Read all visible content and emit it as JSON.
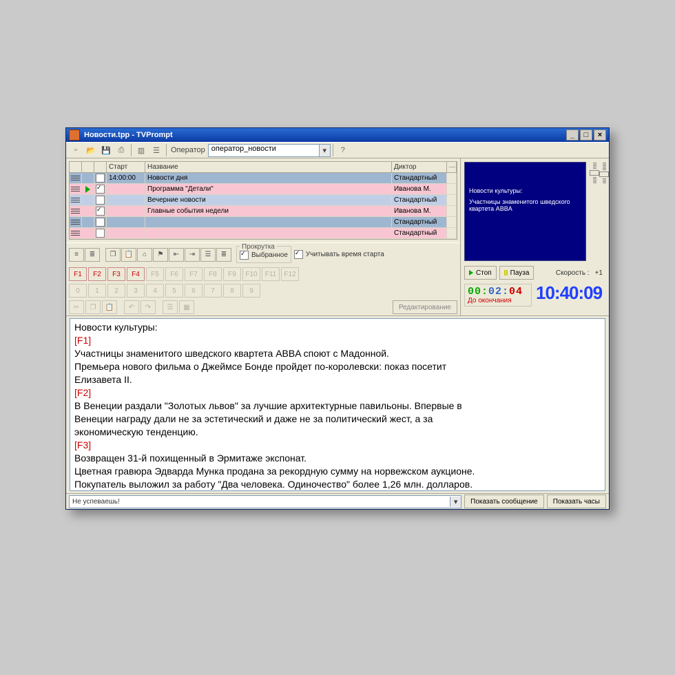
{
  "window": {
    "title": "Новости.tpp - TVPrompt"
  },
  "toolbar": {
    "operator_label": "Оператор",
    "operator_value": "оператор_новости"
  },
  "grid": {
    "headers": {
      "start": "Старт",
      "name": "Название",
      "speaker": "Диктор"
    },
    "rows": [
      {
        "cls": "row-blue",
        "playing": false,
        "checked": false,
        "start": "14:00:00",
        "name": "Новости дня",
        "speaker": "Стандартный"
      },
      {
        "cls": "row-pink",
        "playing": true,
        "checked": true,
        "start": "",
        "name": "Программа \"Детали\"",
        "speaker": "Иванова М."
      },
      {
        "cls": "row-sel",
        "playing": false,
        "checked": false,
        "start": "",
        "name": "Вечерние новости",
        "speaker": "Стандартный"
      },
      {
        "cls": "row-pink",
        "playing": false,
        "checked": true,
        "start": "",
        "name": "Главные события недели",
        "speaker": "Иванова М."
      },
      {
        "cls": "row-blue",
        "playing": false,
        "checked": false,
        "start": "",
        "name": "",
        "speaker": "Стандартный"
      },
      {
        "cls": "row-pink",
        "playing": false,
        "checked": false,
        "start": "",
        "name": "",
        "speaker": "Стандартный"
      }
    ]
  },
  "scroll": {
    "legend": "Прокрутка",
    "selected": "Выбранное",
    "use_start": "Учитывать время старта"
  },
  "fkeys": [
    "F1",
    "F2",
    "F3",
    "F4",
    "F5",
    "F6",
    "F7",
    "F8",
    "F9",
    "F10",
    "F11",
    "F12"
  ],
  "numkeys": [
    "0",
    "1",
    "2",
    "3",
    "4",
    "5",
    "6",
    "7",
    "8",
    "9"
  ],
  "edit_button": "Редактирование",
  "preview": {
    "title": "Новости культуры:",
    "line": "Участницы знаменитого шведского квартета ABBA"
  },
  "controls": {
    "stop": "Стоп",
    "pause": "Пауза",
    "speed_label": "Скорость :",
    "speed_value": "+1"
  },
  "clock": {
    "remain_digits": [
      "00:",
      "02:",
      "04"
    ],
    "remain_label": "До окончания",
    "main": "10:40:09"
  },
  "editor": {
    "l1": "Новости культуры:",
    "m1": "[F1]",
    "l2": " Участницы знаменитого шведского квартета ABBA споют с Мадонной.",
    "l3": " Премьера нового фильма о Джеймсе Бонде пройдет по-королевски: показ посетит",
    "l3b": "Елизавета II.",
    "m2": "[F2]",
    "l4": " В Венеции раздали \"Золотых львов\" за лучшие архитектурные павильоны. Впервые в",
    "l4b": "Венеции награду дали не за эстетический и даже не за политический жест, а за",
    "l4c": "экономическую тенденцию.",
    "m3": "[F3]",
    "l5": " Возвращен 31-й похищенный в Эрмитаже экспонат.",
    "l6": " Цветная гравюра Эдварда Мунка продана за рекордную сумму на норвежском аукционе.",
    "l7": "Покупатель выложил за работу \"Два человека. Одиночество\" более 1,26 млн. долларов."
  },
  "status": {
    "msg": "Не успеваешь!",
    "show_msg": "Показать сообщение",
    "show_clock": "Показать часы"
  }
}
